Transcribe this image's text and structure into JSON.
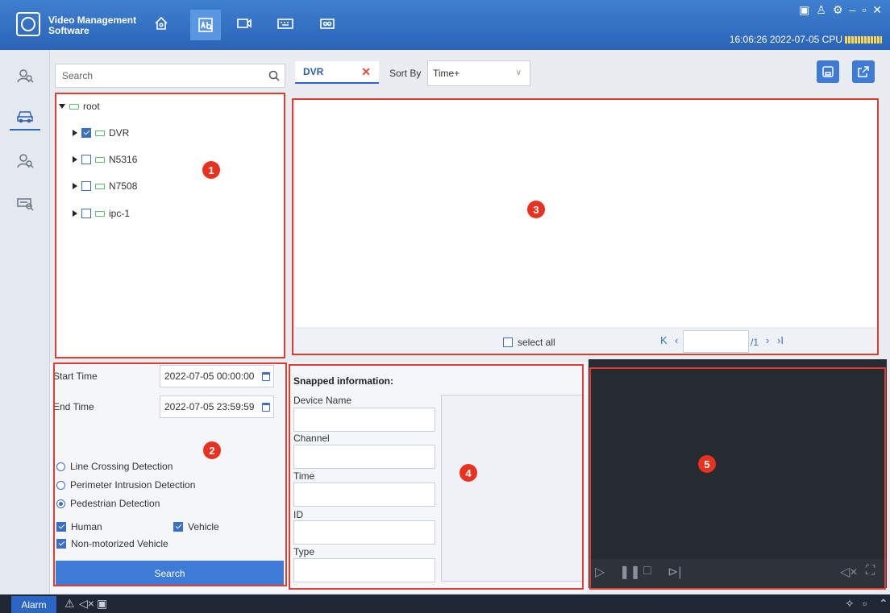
{
  "app": {
    "title_line1": "Video Management",
    "title_line2": "Software"
  },
  "topnav": {
    "items": [
      "home-icon",
      "ai-search-icon",
      "camera-icon",
      "keyboard-icon",
      "record-icon"
    ],
    "active": "ai-search-icon"
  },
  "status": {
    "datetime": "16:06:26 2022-07-05",
    "cpu_label": "CPU"
  },
  "window_controls": [
    "monitor-icon",
    "user-icon",
    "settings-icon",
    "minimize-icon",
    "maximize-icon",
    "close-icon"
  ],
  "search": {
    "placeholder": "Search"
  },
  "tree": {
    "root": "root",
    "items": [
      {
        "label": "DVR",
        "checked": true
      },
      {
        "label": "N5316",
        "checked": false
      },
      {
        "label": "N7508",
        "checked": false
      },
      {
        "label": "ipc-1",
        "checked": false
      }
    ]
  },
  "filter": {
    "start_label": "Start Time",
    "start_value": "2022-07-05 00:00:00",
    "end_label": "End Time",
    "end_value": "2022-07-05 23:59:59",
    "options": [
      "Line Crossing Detection",
      "Perimeter Intrusion Detection",
      "Pedestrian Detection"
    ],
    "selected_option": "Pedestrian Detection",
    "human": "Human",
    "vehicle": "Vehicle",
    "nonmotor": "Non-motorized Vehicle",
    "search_button": "Search"
  },
  "results": {
    "tab_label": "DVR",
    "sort_label": "Sort By",
    "sort_value": "Time+",
    "select_all": "select all",
    "page_total": "/1"
  },
  "snapped": {
    "title": "Snapped information:",
    "device_name": "Device Name",
    "channel": "Channel",
    "time": "Time",
    "id": "ID",
    "type": "Type"
  },
  "markers": [
    "1",
    "2",
    "3",
    "4",
    "5"
  ],
  "statusbar": {
    "alarm": "Alarm"
  },
  "colors": {
    "accent": "#2b66c5",
    "annotation": "#e03c31",
    "video_bg": "#262a31"
  }
}
